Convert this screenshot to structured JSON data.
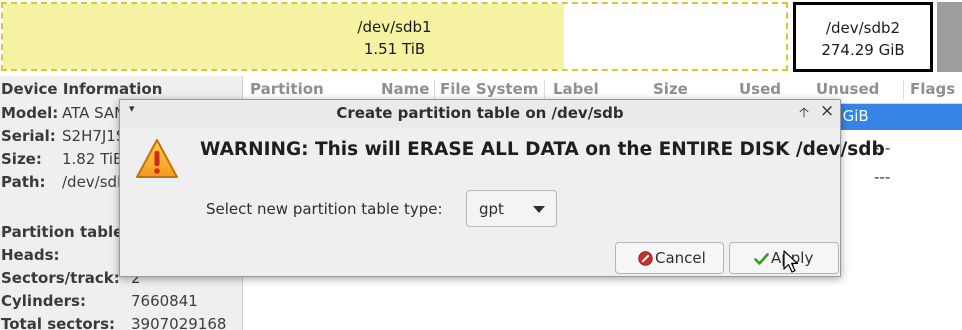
{
  "graph": {
    "partitions": [
      {
        "name": "/dev/sdb1",
        "size": "1.51 TiB",
        "used_fraction": 0.717
      },
      {
        "name": "/dev/sdb2",
        "size": "274.29 GiB"
      }
    ]
  },
  "device_info": {
    "title": "Device Information",
    "fields": [
      {
        "label": "Model:",
        "value": "ATA SAM"
      },
      {
        "label": "Serial:",
        "value": "S2H7J1S"
      },
      {
        "label": "Size:",
        "value": "1.82 TiB"
      },
      {
        "label": "Path:",
        "value": "/dev/sdb"
      }
    ],
    "geometry": [
      {
        "label": "Partition table:",
        "value": ""
      },
      {
        "label": "Heads:",
        "value": ""
      },
      {
        "label": "Sectors/track:",
        "value": "2"
      },
      {
        "label": "Cylinders:",
        "value": "7660841"
      },
      {
        "label": "Total sectors:",
        "value": "3907029168"
      }
    ]
  },
  "partition_list": {
    "columns": [
      "Partition",
      "Name",
      "File System",
      "Label",
      "Size",
      "Used",
      "Unused",
      "Flags"
    ],
    "selected_unused": ".12 GiB",
    "row2_unused": "---",
    "row3_unused": "---"
  },
  "dialog": {
    "title": "Create partition table on /dev/sdb",
    "warning": "WARNING:  This will ERASE ALL DATA on the ENTIRE DISK /dev/sdb",
    "select_label": "Select new partition table type:",
    "table_type": "gpt",
    "cancel_label": "Cancel",
    "apply_label": "Apply"
  },
  "icons": {
    "warning": "warning-triangle-icon",
    "cancel": "cancel-circle-icon",
    "apply": "checkmark-icon"
  },
  "colors": {
    "used_fill": "#f5f2a1",
    "partition_border": "#d8c63a",
    "selection": "#3584e4",
    "unallocated": "#9d9d9d"
  }
}
